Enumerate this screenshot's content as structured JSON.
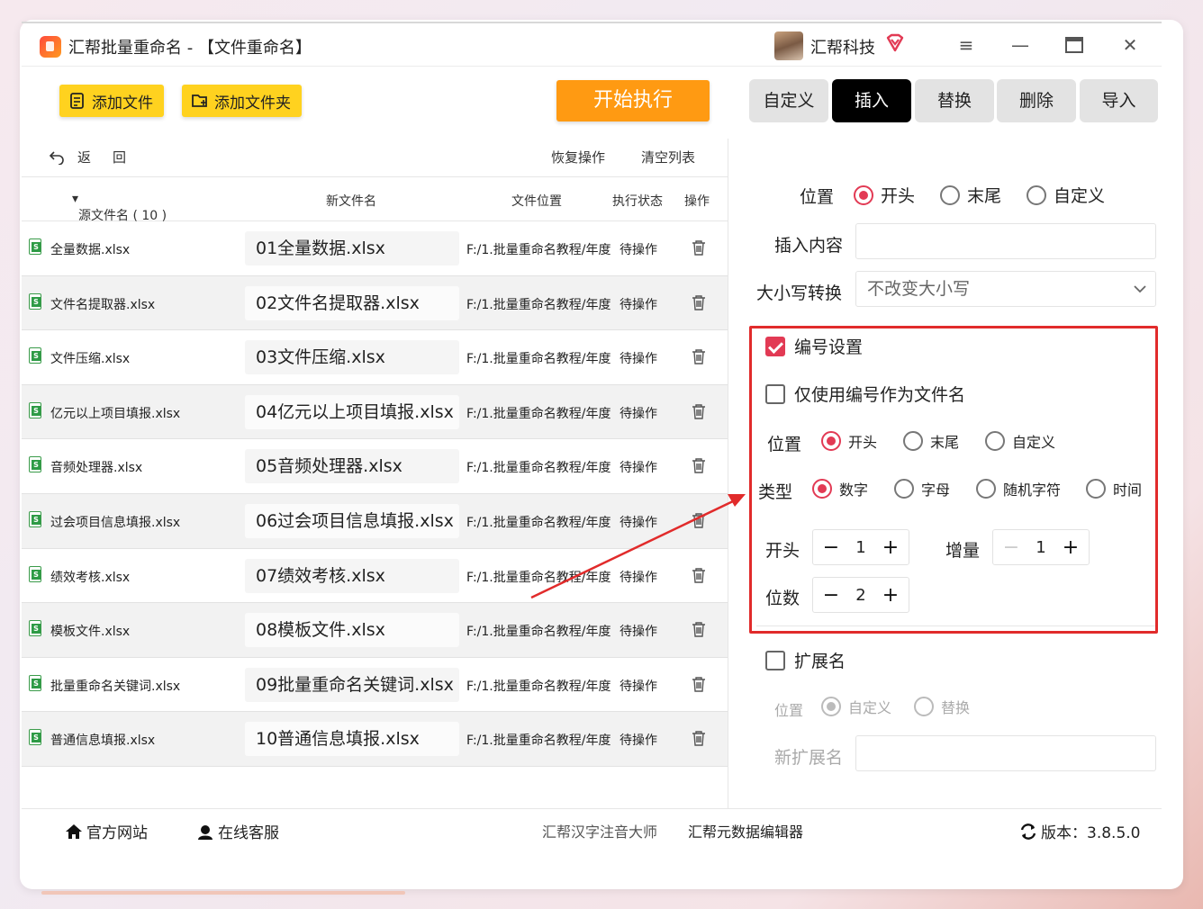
{
  "window": {
    "title": "汇帮批量重命名 - 【文件重命名】",
    "user_name": "汇帮科技"
  },
  "toolbar": {
    "add_file": "添加文件",
    "add_folder": "添加文件夹",
    "start": "开始执行"
  },
  "tabs": [
    "自定义",
    "插入",
    "替换",
    "删除",
    "导入"
  ],
  "active_tab": "插入",
  "list": {
    "back": "返",
    "back2": "回",
    "restore": "恢复操作",
    "clear": "清空列表",
    "columns": {
      "source": "源文件名 ( 10 )",
      "new_name": "新文件名",
      "location": "文件位置",
      "status": "执行状态",
      "action": "操作"
    },
    "rows": [
      {
        "src": "全量数据.xlsx",
        "new": "01全量数据.xlsx",
        "loc": "F:/1.批量重命名教程/年度",
        "status": "待操作"
      },
      {
        "src": "文件名提取器.xlsx",
        "new": "02文件名提取器.xlsx",
        "loc": "F:/1.批量重命名教程/年度",
        "status": "待操作"
      },
      {
        "src": "文件压缩.xlsx",
        "new": "03文件压缩.xlsx",
        "loc": "F:/1.批量重命名教程/年度",
        "status": "待操作"
      },
      {
        "src": "亿元以上项目填报.xlsx",
        "new": "04亿元以上项目填报.xlsx",
        "loc": "F:/1.批量重命名教程/年度",
        "status": "待操作"
      },
      {
        "src": "音频处理器.xlsx",
        "new": "05音频处理器.xlsx",
        "loc": "F:/1.批量重命名教程/年度",
        "status": "待操作"
      },
      {
        "src": "过会项目信息填报.xlsx",
        "new": "06过会项目信息填报.xlsx",
        "loc": "F:/1.批量重命名教程/年度",
        "status": "待操作"
      },
      {
        "src": "绩效考核.xlsx",
        "new": "07绩效考核.xlsx",
        "loc": "F:/1.批量重命名教程/年度",
        "status": "待操作"
      },
      {
        "src": "模板文件.xlsx",
        "new": "08模板文件.xlsx",
        "loc": "F:/1.批量重命名教程/年度",
        "status": "待操作"
      },
      {
        "src": "批量重命名关键词.xlsx",
        "new": "09批量重命名关键词.xlsx",
        "loc": "F:/1.批量重命名教程/年度",
        "status": "待操作"
      },
      {
        "src": "普通信息填报.xlsx",
        "new": "10普通信息填报.xlsx",
        "loc": "F:/1.批量重命名教程/年度",
        "status": "待操作"
      }
    ]
  },
  "insert": {
    "position_label": "位置",
    "position_options": [
      "开头",
      "末尾",
      "自定义"
    ],
    "position_selected": "开头",
    "content_label": "插入内容",
    "content_value": "",
    "case_label": "大小写转换",
    "case_value": "不改变大小写"
  },
  "numbering": {
    "enable_label": "编号设置",
    "enabled": true,
    "only_number_label": "仅使用编号作为文件名",
    "only_number": false,
    "position_label": "位置",
    "position_options": [
      "开头",
      "末尾",
      "自定义"
    ],
    "position_selected": "开头",
    "type_label": "类型",
    "type_options": [
      "数字",
      "字母",
      "随机字符",
      "时间"
    ],
    "type_selected": "数字",
    "start_label": "开头",
    "start_value": "1",
    "step_label": "增量",
    "step_value": "1",
    "digits_label": "位数",
    "digits_value": "2",
    "minus": "−",
    "plus": "+"
  },
  "extension": {
    "enable_label": "扩展名",
    "enabled": false,
    "position_label": "位置",
    "options": [
      "自定义",
      "替换"
    ],
    "selected": "自定义",
    "new_ext_label": "新扩展名",
    "new_ext_value": ""
  },
  "footer": {
    "website": "官方网站",
    "service": "在线客服",
    "link1": "汇帮汉字注音大师",
    "link2": "汇帮元数据编辑器",
    "version": "版本：3.8.5.0"
  },
  "colors": {
    "accent_red": "#e23a54",
    "start_orange": "#ff9a12",
    "button_yellow": "#ffd21f",
    "highlight_box": "#e12b2b"
  }
}
